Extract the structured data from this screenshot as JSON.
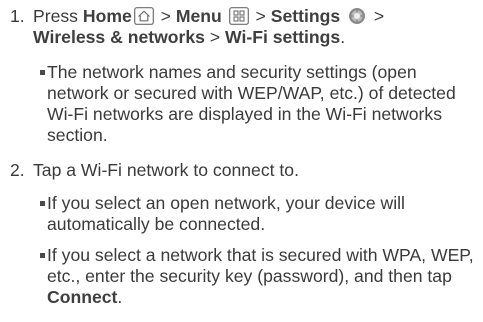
{
  "steps": [
    {
      "number": "1.",
      "parts": {
        "press": "Press",
        "home": "Home",
        "sep1": ">",
        "menu": "Menu",
        "sep2": ">",
        "settings": "Settings",
        "sep3": ">",
        "wireless": "Wireless & networks",
        "sep4": ">",
        "wifi_settings": "Wi-Fi settings",
        "period": "."
      },
      "icons": [
        "home-icon",
        "menu-grid-icon",
        "settings-gear-icon"
      ],
      "bullets": [
        "The network names and security settings (open network or secured with WEP/WAP, etc.) of detected Wi-Fi networks are displayed in the Wi-Fi networks section."
      ]
    },
    {
      "number": "2.",
      "text": "Tap a Wi-Fi network to connect to.",
      "bullets": [
        "If you select an open network, your device will automatically be connected."
      ],
      "last_bullet": {
        "lead": "If you select a network that is secured with WPA, WEP, etc., enter the security key (password), and then tap ",
        "connect": "Connect",
        "end": "."
      }
    }
  ],
  "colors": {
    "text": "#3a3a3a",
    "icon_gray": "#7a7a7a"
  }
}
